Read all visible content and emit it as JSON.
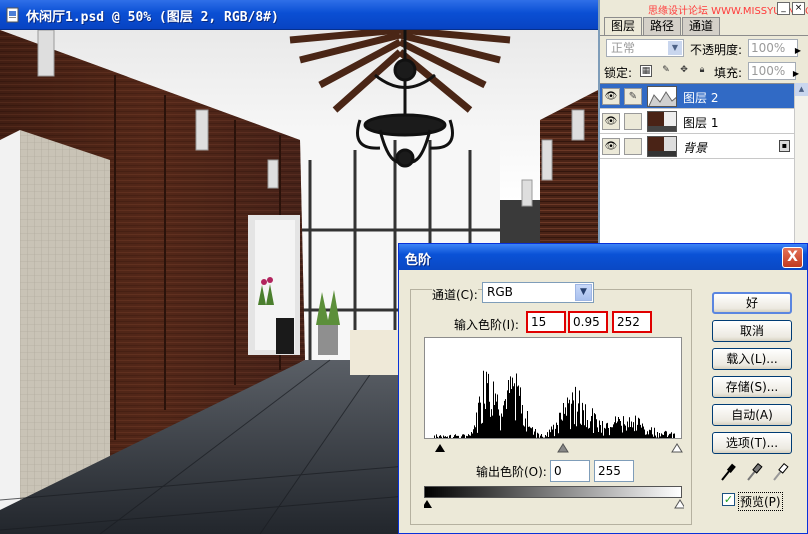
{
  "document": {
    "title": "休闲厅1.psd @ 50% (图层 2, RGB/8#)"
  },
  "layers_panel": {
    "watermark": "思缘设计论坛 WWW.MISSYUAN.COM",
    "tabs": [
      {
        "label": "图层",
        "active": true
      },
      {
        "label": "路径",
        "active": false
      },
      {
        "label": "通道",
        "active": false
      }
    ],
    "blend_mode": "正常",
    "opacity_label": "不透明度:",
    "opacity_value": "100%",
    "lock_label": "锁定:",
    "fill_label": "填充:",
    "fill_value": "100%",
    "layers": [
      {
        "name": "图层 2",
        "selected": true
      },
      {
        "name": "图层 1",
        "selected": false
      },
      {
        "name": "背景",
        "selected": false
      }
    ]
  },
  "levels_dialog": {
    "title": "色阶",
    "close": "X",
    "channel_label": "通道(C):",
    "channel_value": "RGB",
    "input_levels_label": "输入色阶(I):",
    "input_black": "15",
    "input_gamma": "0.95",
    "input_white": "252",
    "output_levels_label": "输出色阶(O):",
    "output_black": "0",
    "output_white": "255",
    "buttons": {
      "ok": "好",
      "cancel": "取消",
      "load": "载入(L)...",
      "save": "存储(S)...",
      "auto": "自动(A)",
      "options": "选项(T)..."
    },
    "preview_label": "预览(P)",
    "preview_checked": true
  },
  "colors": {
    "xp_blue": "#0a52d6",
    "panel_bg": "#ece9d8",
    "selected_layer": "#316ac5",
    "highlight_red": "#e00000"
  }
}
